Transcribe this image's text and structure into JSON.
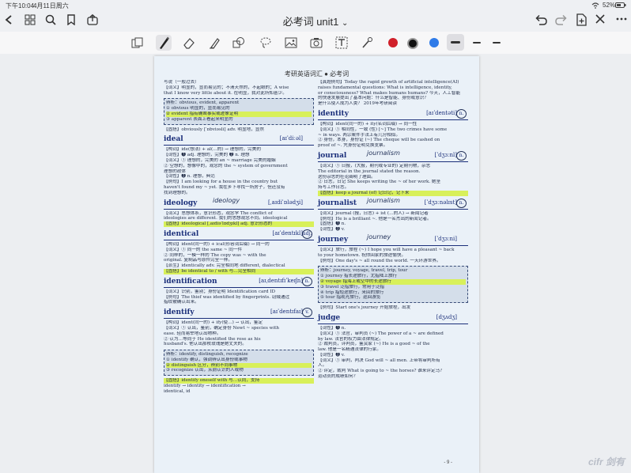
{
  "status": {
    "time": "下午10:04",
    "date": "4月11日周六",
    "battery": "52%"
  },
  "header": {
    "title": "必考词 unit1",
    "title_chevron": "⌄"
  },
  "toolbar": {
    "tools": [
      "pages-icon",
      "pen-icon",
      "eraser-icon",
      "highlighter-icon",
      "shapes-icon",
      "lasso-icon",
      "image-icon",
      "camera-icon",
      "text-icon",
      "laser-icon"
    ],
    "colors": [
      "#d0202a",
      "#111111",
      "#2f7be8"
    ],
    "stroke_widths": [
      "thick",
      "medium",
      "thin"
    ]
  },
  "page": {
    "running_header": "考研英语词汇 ● 必考词",
    "page_number": "- 9 -",
    "left_lines_top": [
      "写说（一般过去）",
      "【词义】明显的，显而易见的；不清天然的，不起眼的；A wise",
      "that I know very little about it. 在明显，我对此所知甚少。"
    ],
    "left_box1": [
      "辨析：obvious, evident, apparent",
      "① obvious 明显的，显而易见的",
      "② evident 指有确凿事实或迹象证明",
      "③ apparent 表面上看起来明显的"
    ],
    "left_lines_a": [
      "【固搭】obviously [ˈɒbviəsli] adv. 明显地，显然"
    ],
    "entries_left": [
      {
        "word": "ideal",
        "phon": "[aɪˈdiːəl]",
        "hw": "",
        "circ": "",
        "lines": [
          "【构词】ide(想法) + al(…的) → 理想的，完美的",
          "【词性】❶ adj. 理想的，完美的 ❷ n. 理想",
          "【词义】① 理想的，完美的 an ~ marriage 完美的婚姻",
          "② 空想的，想像中的，观念的 the ~ system of government",
          "理想的政体",
          "【词性】❷ n. 理想，典范",
          "【例句】I am looking for a house in the country but",
          "haven't found my ~ yet. 我在乡下寻找一所房子，但还没有",
          "找到理想的。"
        ]
      },
      {
        "word": "ideology",
        "phon": "[ˌaɪdiˈɒlədʒi]",
        "hw": "ideology",
        "circ": "",
        "lines": [
          "【词义】思想体系，意识形态，观念学 The conflict of",
          "ideologies are different. 我们的思想观念不同。ideological",
          "【固搭】ideological [ˌaɪdiəˈlɒdʒɪkl] adj. 意识形态的"
        ]
      },
      {
        "word": "identical",
        "phon": "[aɪˈdentɪkl]",
        "hw": "",
        "circ": "adj.",
        "lines": [
          "【构词】ident(同一的) + ical(形容词后缀) → 同一的",
          "【词义】① 同一的 the same ~ 同一件",
          "② 同样的，一模一样的 The copy was ~ with the",
          "original. 复制品与原件完全一样。",
          "【派生】identically adv. 完全相同地 different, dialectical",
          "【固搭】be identical to / with 与…完全相同"
        ]
      },
      {
        "word": "identification",
        "phon": "[aɪˌdentɪfɪˈkeɪʃn]",
        "hw": "",
        "circ": "n.",
        "lines": [
          "【词义】识别，鉴别；身份证明 Identification card ID",
          "【例句】The thief was identified by fingerprints. 窃贼通过",
          "指纹被确认出来。"
        ]
      },
      {
        "word": "identify",
        "phon": "[aɪˈdentɪfaɪ]",
        "hw": "",
        "circ": "v.",
        "lines": [
          "【构词】ident(同一的) + ify(使…) → 认出，鉴定",
          "【词义】① 认出，鉴别，确定身份 Newt ~ species with",
          "ease. 轻而易举地认出物种。",
          "② 认为…等同于 He identified the rose as his",
          "husband's. 他认出那枚玫瑰是她丈夫的。"
        ]
      }
    ],
    "left_box2": [
      "辨析：identify, distinguish, recognize",
      "① identify 确认，强调辨认出身份或事物",
      "② distinguish 区分，辨别不同事物",
      "③ recognize 认出，从前认识的人或物"
    ],
    "left_lines_bottom": [
      "【固搭】identify oneself with 与…认同，支持",
      "identify → identity → identification →",
      "identical, id"
    ],
    "right_lines_top": [
      "【真题例句】Today the rapid growth of artificial intelligence(AI)",
      "raises fundamental questions: What is intelligence, identity,",
      "or consciousness? What makes humans humans? 今天，人工智能",
      "的快速发展提出了基本问题：什么是智能、身份或意识？",
      "是什么使人成为人类？ 2019年考研阅读"
    ],
    "entries_right": [
      {
        "word": "identity",
        "phon": "[aɪˈdentəti]",
        "hw": "",
        "circ": "n.",
        "lines": [
          "【构词】ident(同一的) + ity(名词后缀) → 同一性",
          "【词义】① 相同性，一致 (性) [~] The two crimes have some",
          "~ in ways. 两宗案件手法上有几分相似。",
          "② 身份，本身，身份证 (~) The cheque will be cashed on",
          "proof of ~. 凭身份证明兑换支票。"
        ]
      },
      {
        "word": "journal",
        "phon": "[ˈdʒɜːnl]",
        "hw": "journalism",
        "circ": "n.",
        "lines": [
          "【词义】① 日报，(大报，期刊或专业的) 定期刊物，杂志",
          "The editorial in the journal stated the reason.",
          "这份杂志的社论阐明了理由。",
          "② 日志，日记 She keeps writing the ~ of her work. 她坚",
          "持写工作日志。",
          "【固搭】keep a journal (of) 记日记，记下来"
        ]
      },
      {
        "word": "journalist",
        "phon": "[ˈdʒɜːnəlɪst]",
        "hw": "journalism",
        "circ": "n.",
        "lines": [
          "【词义】journal (报，日志) + ist (…的人) → 新闻记者",
          "【例句】He is a brilliant ~. 他是一名杰出的新闻记者。",
          "【固搭】❶ n.",
          "【词性】❷ v."
        ]
      },
      {
        "word": "journey",
        "phon": "[ˈdʒɜːni]",
        "hw": "journey",
        "circ": "",
        "lines": [
          "【词义】旅行，旅程 (~) I hope you will have a pleasant ~ back",
          "to your hometown. 祝你回家的旅途愉快。",
          "【例句】One day's ~ all round the world. 一天环游世界。"
        ]
      }
    ],
    "right_box": [
      "辨析：journey, voyage, travel, trip, tour",
      "① journey 指长途旅行，尤指陆上旅行",
      "② voyage 指海上或空中的长途旅行",
      "③ travel 泛指旅行，常用于泛指",
      "④ trip 指短途旅行，来回的旅行",
      "⑤ tour 指观光旅行，巡回游览"
    ],
    "right_lines_b": [
      "【例句】Start one's journey 开始旅程，出发"
    ],
    "entries_right2": [
      {
        "word": "judge",
        "phon": "[dʒʌdʒ]",
        "hw": "",
        "circ": "",
        "lines": [
          "【词性】❶ n.",
          "【词义】① 法官，审判员 (~) The power of a ~ are defined",
          "by law. 法官的权力由法律规定。",
          "② 裁判员，评判员，鉴赏家 (~) He is a good ~ of the",
          "law. 他是一名精通法律的行家。",
          "【词性】❷ v.",
          "【词义】① 审判，判决 God will ~ all men. 上帝将审判所有",
          "人。",
          "② 评定，裁判 What is going to ~ the horses? 谁来评定马？",
          "运动员的成绩如何？"
        ]
      }
    ]
  },
  "watermark": "cifr 剑有"
}
